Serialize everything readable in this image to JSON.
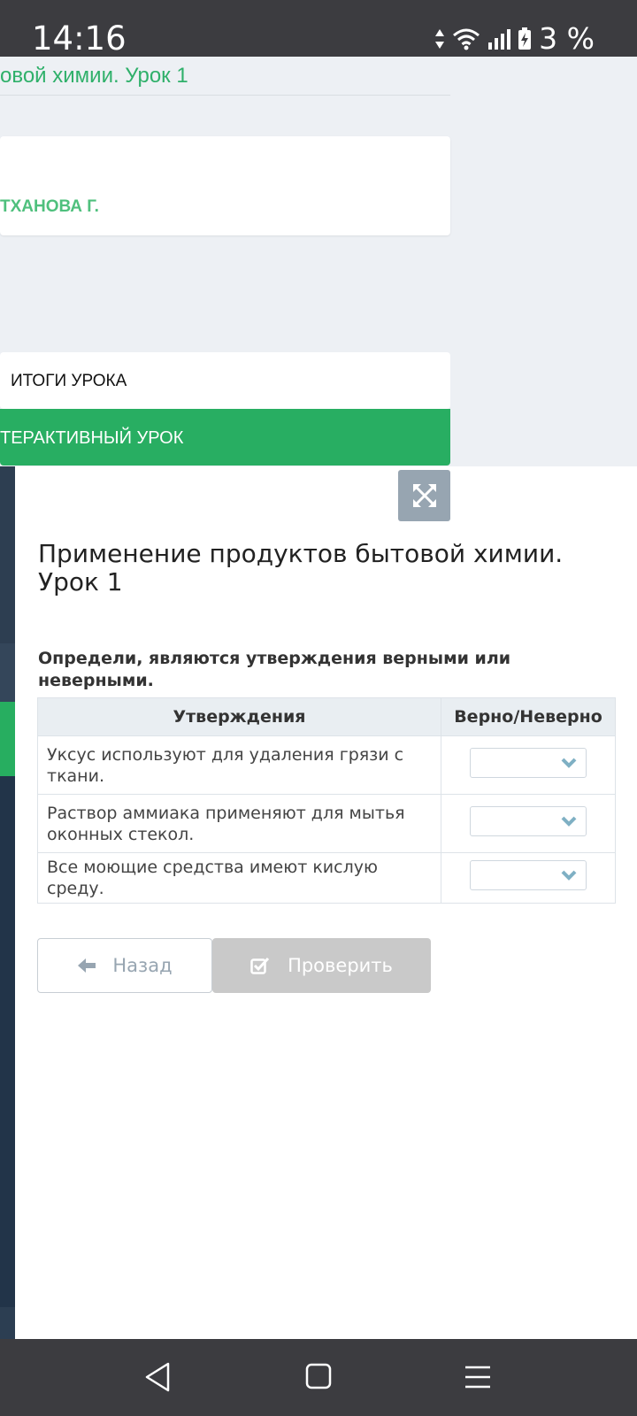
{
  "status_bar": {
    "time": "14:16",
    "battery": "3 %"
  },
  "page": {
    "course_title": "овой химии. Урок 1",
    "teacher": "ТХАНОВА Г.",
    "tab_summary": "ИТОГИ УРОКА",
    "tab_interactive": "ТЕРАКТИВНЫЙ УРОК"
  },
  "lesson": {
    "title": "Применение продуктов бытовой химии. Урок 1",
    "instruction": "Определи, являются утверждения верными или неверными.",
    "table": {
      "headers": [
        "Утверждения",
        "Верно/Неверно"
      ],
      "rows": [
        {
          "statement": "Уксус используют для удаления грязи с ткани.",
          "answer": ""
        },
        {
          "statement": "Раствор аммиака применяют для мытья оконных стекол.",
          "answer": ""
        },
        {
          "statement": "Все моющие средства имеют кислую среду.",
          "answer": ""
        }
      ]
    },
    "buttons": {
      "back": "Назад",
      "check": "Проверить"
    }
  },
  "icons": {
    "expand": "expand-icon",
    "back": "arrow-left-icon",
    "check": "checkbox-icon",
    "chevron": "chevron-down-icon",
    "nav_back": "nav-back-icon",
    "nav_home": "nav-home-icon",
    "nav_menu": "nav-menu-icon"
  },
  "colors": {
    "accent_green": "#28ae62",
    "text_green": "#2fb06a",
    "chevron": "#7fb0c4"
  }
}
